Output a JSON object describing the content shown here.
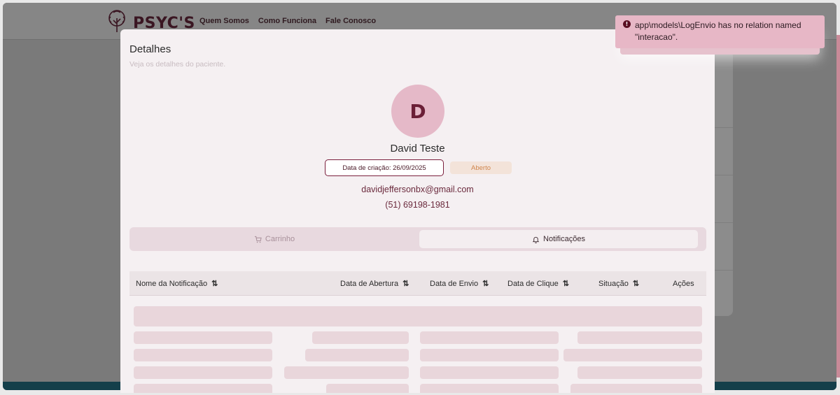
{
  "header": {
    "logo_text": "PSYC'S",
    "nav": [
      "Quem Somos",
      "Como Funciona",
      "Fale Conosco"
    ]
  },
  "modal": {
    "title": "Detalhes",
    "subtitle": "Veja os detalhes do paciente.",
    "patient": {
      "initial": "D",
      "name": "David Teste",
      "created_label": "Data de criação: 26/09/2025",
      "status": "Aberto",
      "email": "davidjeffersonbx@gmail.com",
      "phone": "(51) 69198-1981"
    },
    "tabs": [
      {
        "label": "Carrinho",
        "icon": "cart-icon",
        "active": false
      },
      {
        "label": "Notificações",
        "icon": "bell-icon",
        "active": true
      }
    ],
    "table": {
      "columns": [
        "Nome da Notificação",
        "Data de Abertura",
        "Data de Envio",
        "Data de Clique",
        "Situação",
        "Ações"
      ],
      "sort_glyph": "⇅"
    }
  },
  "toast": {
    "icon": "error-icon",
    "message": "app\\models\\LogEnvio has no relation named \"interacao\"."
  },
  "colors": {
    "brand": "#7a1e3c",
    "avatar": "#e5b9c8",
    "toast": "#e7b7c6",
    "status": "#d0864e"
  }
}
